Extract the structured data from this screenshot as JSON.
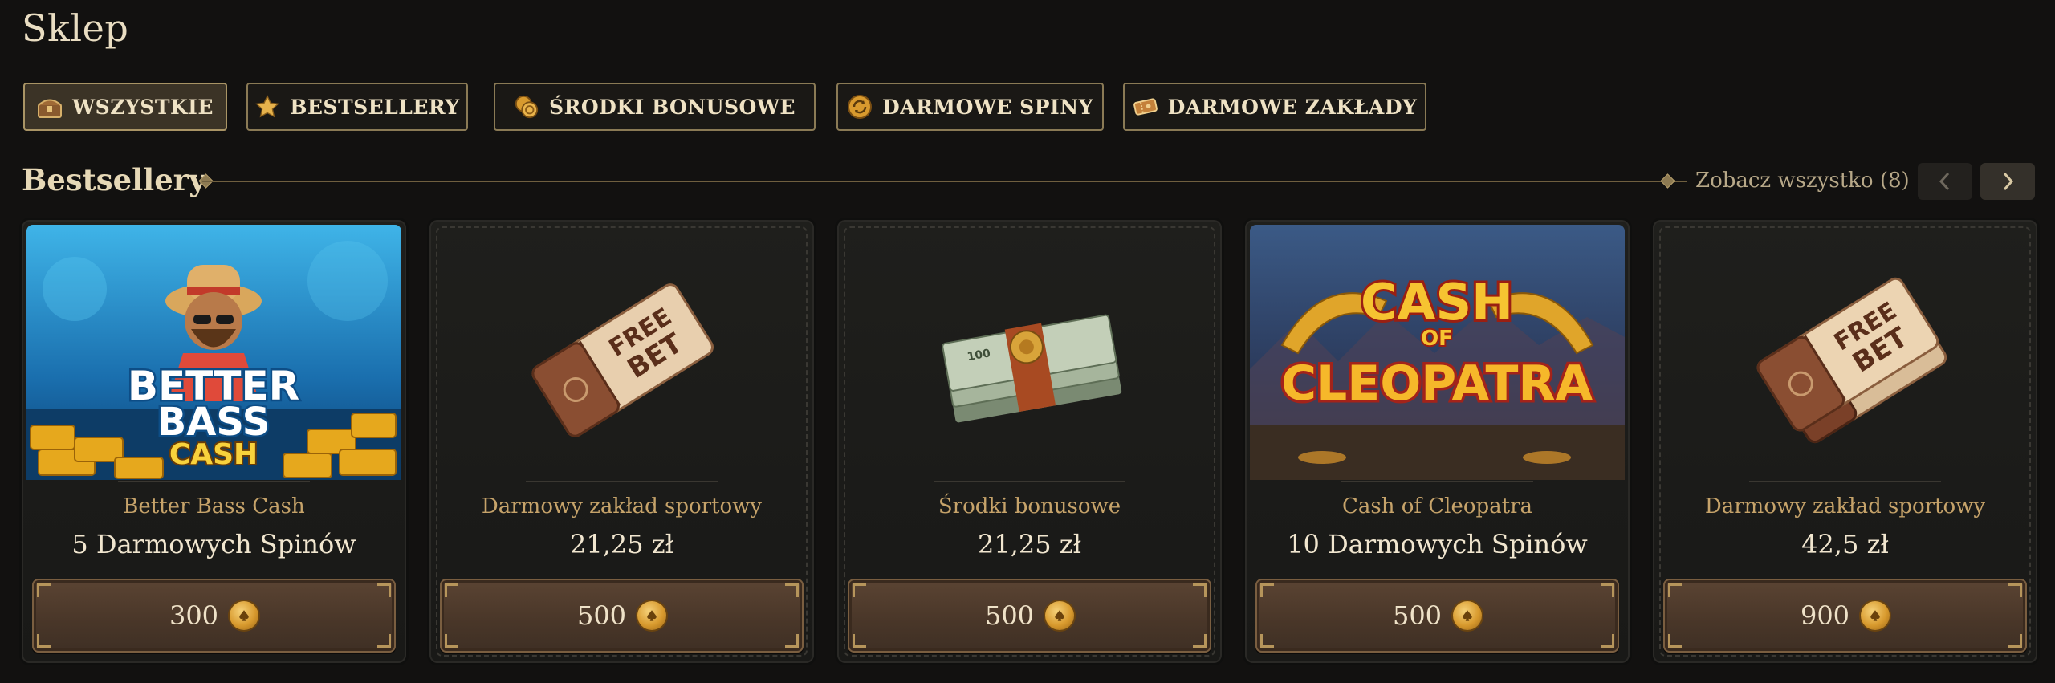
{
  "page": {
    "title": "Sklep"
  },
  "tabs": [
    {
      "label": "WSZYSTKIE",
      "icon": "treasure-chest-icon",
      "active": true
    },
    {
      "label": "BESTSELLERY",
      "icon": "star-icon",
      "active": false
    },
    {
      "label": "ŚRODKI BONUSOWE",
      "icon": "coins-icon",
      "active": false
    },
    {
      "label": "DARMOWE SPINY",
      "icon": "spin-icon",
      "active": false
    },
    {
      "label": "DARMOWE ZAKŁADY",
      "icon": "ticket-icon",
      "active": false
    }
  ],
  "section": {
    "title": "Bestsellery",
    "see_all": "Zobacz wszystko (8)",
    "prev_icon": "chevron-left-icon",
    "next_icon": "chevron-right-icon"
  },
  "cards": [
    {
      "name": "Better Bass Cash",
      "value": "5 Darmowych Spinów",
      "price": "300",
      "image": "better-bass-cash-game-art",
      "art_text": {
        "line1": "BETTER",
        "line2": "BASS",
        "line3": "CASH"
      }
    },
    {
      "name": "Darmowy zakład sportowy",
      "value": "21,25 zł",
      "price": "500",
      "image": "free-bet-ticket",
      "art_text": {
        "line1": "FREE",
        "line2": "BET"
      }
    },
    {
      "name": "Środki bonusowe",
      "value": "21,25 zł",
      "price": "500",
      "image": "cash-bundle",
      "art_text": {
        "line1": "100"
      }
    },
    {
      "name": "Cash of Cleopatra",
      "value": "10 Darmowych Spinów",
      "price": "500",
      "image": "cash-of-cleopatra-game-art",
      "art_text": {
        "line1": "CASH",
        "line2": "OF",
        "line3": "CLEOPATRA"
      }
    },
    {
      "name": "Darmowy zakład sportowy",
      "value": "42,5 zł",
      "price": "900",
      "image": "free-bet-tickets",
      "art_text": {
        "line1": "FREE",
        "line2": "BET"
      }
    }
  ],
  "colors": {
    "background": "#121110",
    "accent_gold": "#c6a36a",
    "button_brown": "#4a3729",
    "coin": "#d89a2e"
  }
}
